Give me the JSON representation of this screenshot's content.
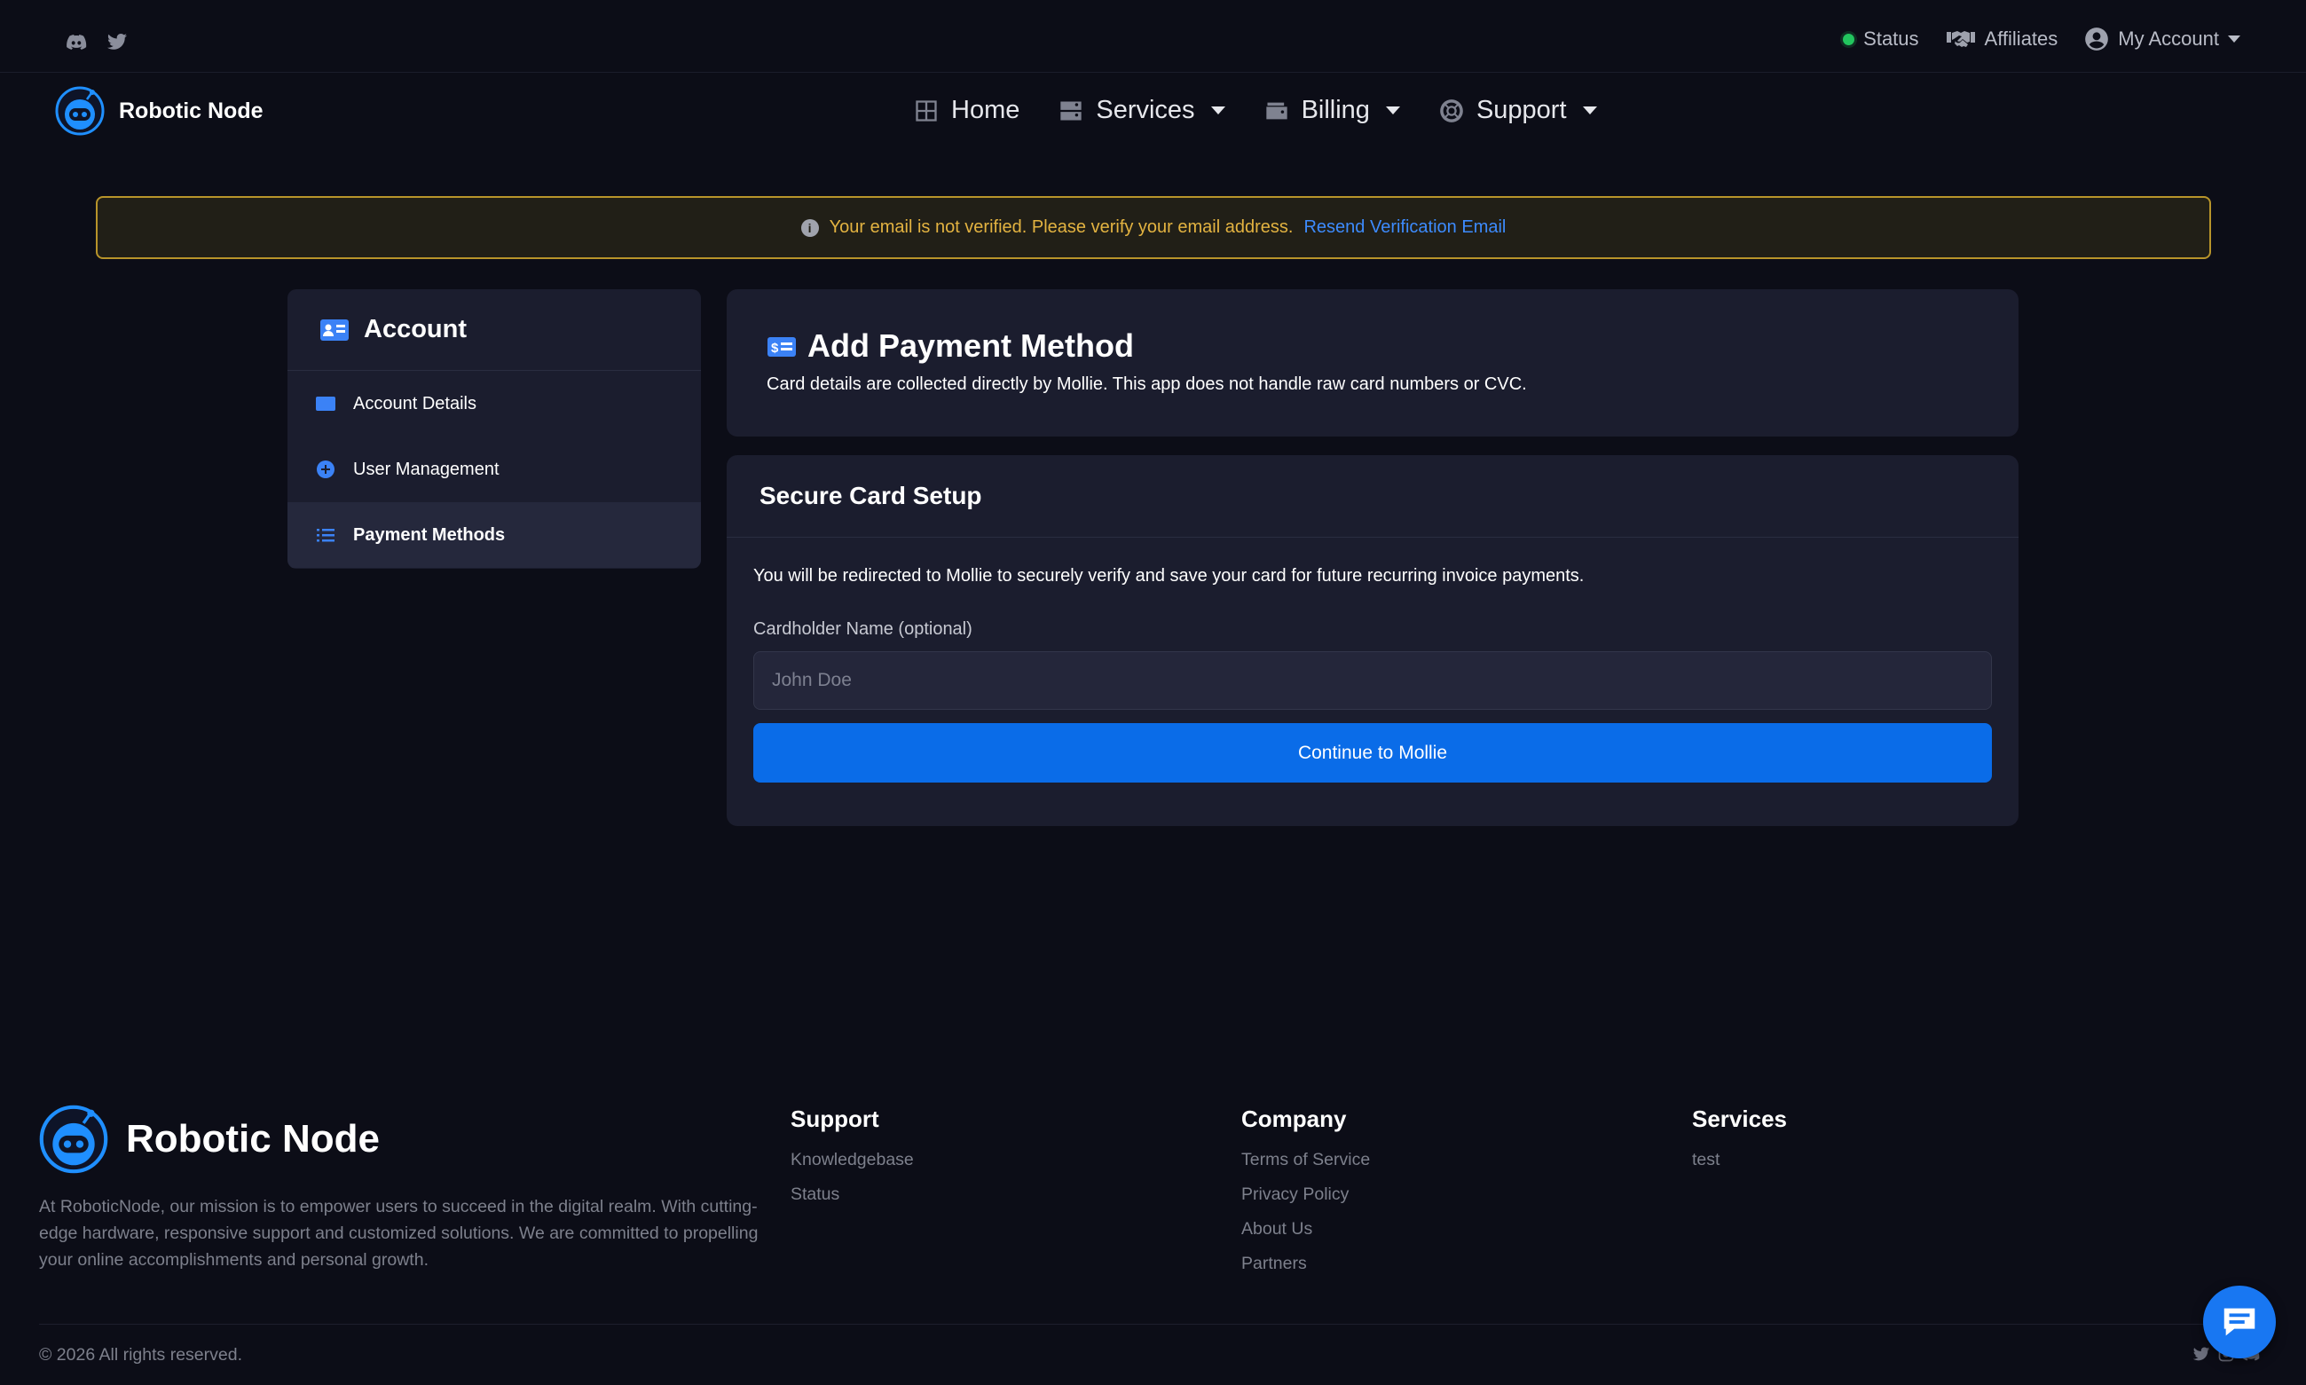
{
  "topbar": {
    "social": [
      "discord-icon",
      "twitter-icon"
    ],
    "status_label": "Status",
    "affiliates_label": "Affiliates",
    "account_label": "My Account"
  },
  "nav": {
    "brand": "Robotic Node",
    "items": [
      {
        "label": "Home",
        "icon": "grid-icon"
      },
      {
        "label": "Services",
        "icon": "server-icon"
      },
      {
        "label": "Billing",
        "icon": "wallet-icon"
      },
      {
        "label": "Support",
        "icon": "lifebuoy-icon"
      }
    ]
  },
  "alert": {
    "message": "Your email is not verified. Please verify your email address.",
    "link": "Resend Verification Email"
  },
  "sidebar": {
    "title": "Account",
    "items": [
      {
        "label": "Account Details",
        "icon": "card-icon"
      },
      {
        "label": "User Management",
        "icon": "plus-circle-icon"
      },
      {
        "label": "Payment Methods",
        "icon": "list-icon",
        "active": true
      }
    ]
  },
  "page": {
    "title": "Add Payment Method",
    "description": "Card details are collected directly by Mollie. This app does not handle raw card numbers or CVC."
  },
  "setup": {
    "title": "Secure Card Setup",
    "text": "You will be redirected to Mollie to securely verify and save your card for future recurring invoice payments.",
    "name_label": "Cardholder Name (optional)",
    "name_placeholder": "John Doe",
    "name_value": "",
    "button": "Continue to Mollie"
  },
  "footer": {
    "brand": "Robotic Node",
    "about": "At RoboticNode, our mission is to empower users to succeed in the digital realm. With cutting-edge hardware, responsive support and customized solutions. We are committed to propelling your online accomplishments and personal growth.",
    "columns": [
      {
        "title": "Support",
        "links": [
          "Knowledgebase",
          "Status"
        ]
      },
      {
        "title": "Company",
        "links": [
          "Terms of Service",
          "Privacy Policy",
          "About Us",
          "Partners"
        ]
      },
      {
        "title": "Services",
        "links": [
          "test"
        ]
      }
    ],
    "copyright": "© 2026 All rights reserved."
  },
  "colors": {
    "background": "#0c0d17",
    "card": "#1b1d2e",
    "accent": "#0a6ce8",
    "warning": "#e3b341",
    "link": "#3d8bfd",
    "status_ok": "#22c55e"
  }
}
